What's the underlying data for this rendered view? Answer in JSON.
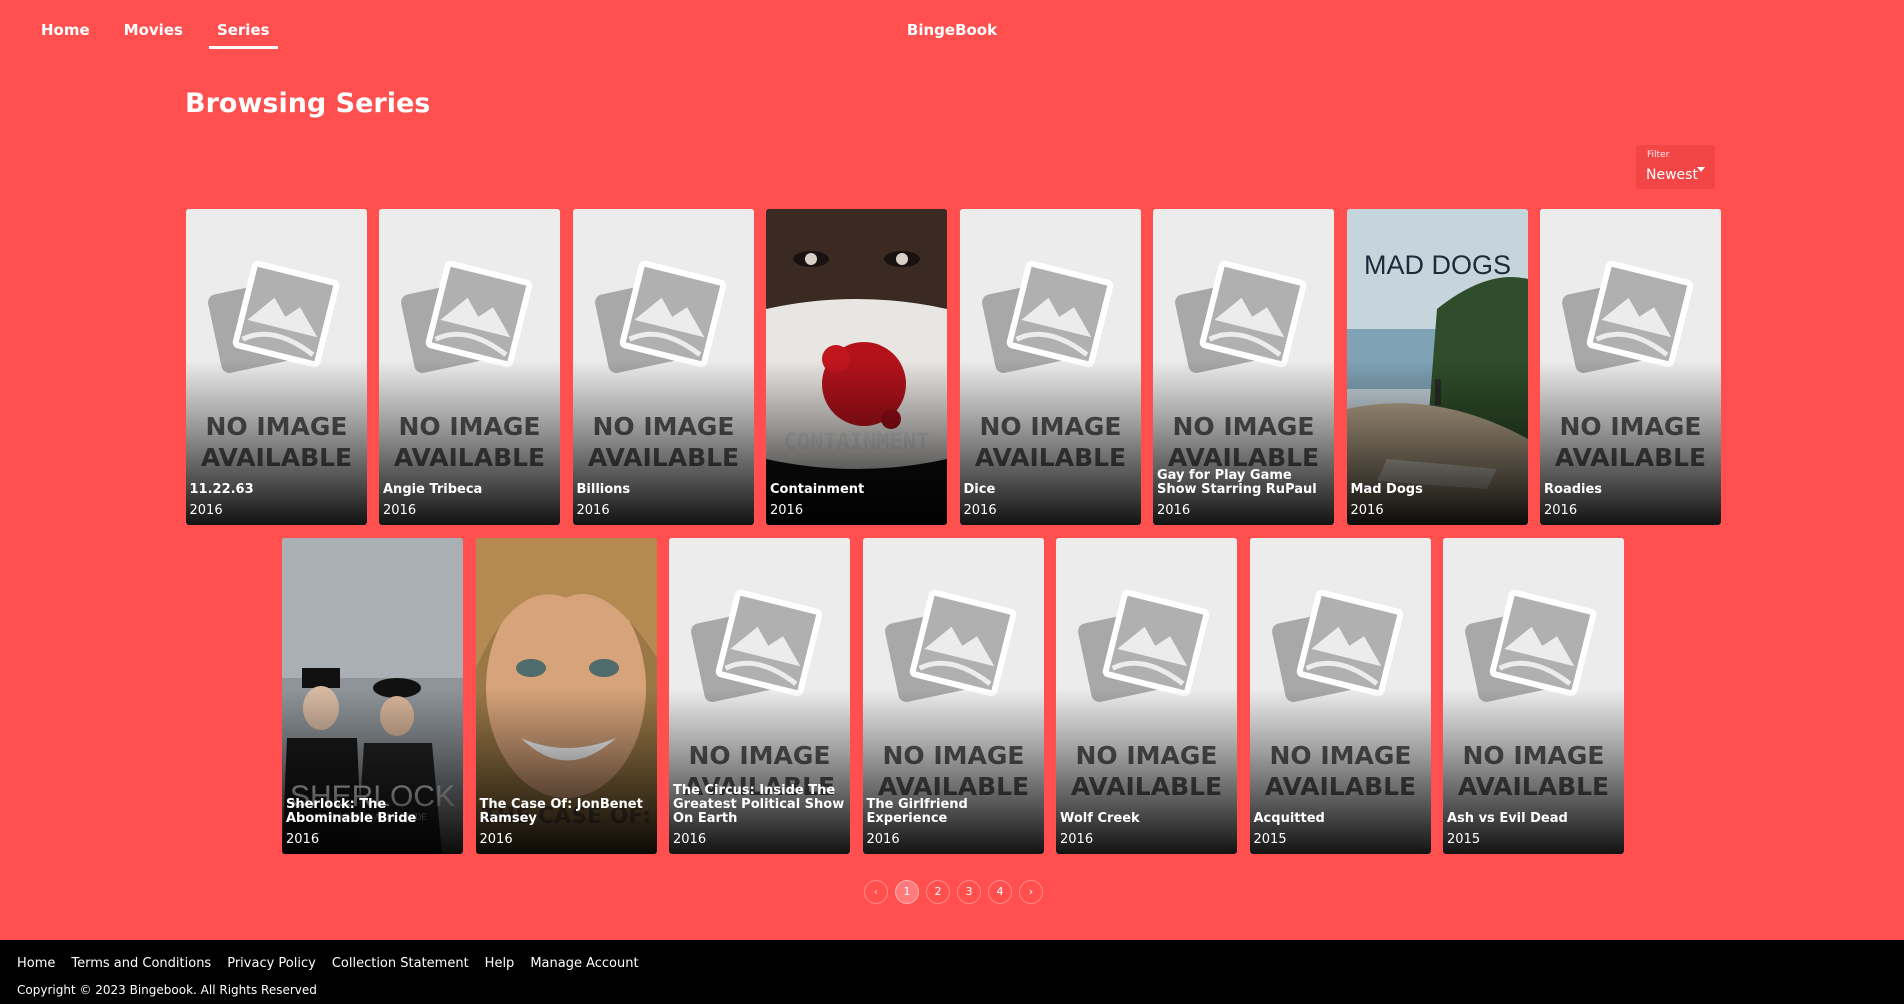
{
  "nav": {
    "home": "Home",
    "movies": "Movies",
    "series": "Series",
    "brand": "BingeBook"
  },
  "page_title": "Browsing Series",
  "filter": {
    "label": "Filter",
    "value": "Newest"
  },
  "placeholder_text": {
    "line1": "NO IMAGE",
    "line2": "AVAILABLE"
  },
  "row1": [
    {
      "title": "11.22.63",
      "year": "2016",
      "poster": "none"
    },
    {
      "title": "Angie Tribeca",
      "year": "2016",
      "poster": "none"
    },
    {
      "title": "Billions",
      "year": "2016",
      "poster": "none"
    },
    {
      "title": "Containment",
      "year": "2016",
      "poster": "containment"
    },
    {
      "title": "Dice",
      "year": "2016",
      "poster": "none"
    },
    {
      "title": "Gay for Play Game Show Starring RuPaul",
      "year": "2016",
      "poster": "none"
    },
    {
      "title": "Mad Dogs",
      "year": "2016",
      "poster": "maddogs"
    },
    {
      "title": "Roadies",
      "year": "2016",
      "poster": "none"
    }
  ],
  "row2": [
    {
      "title": "Sherlock: The Abominable Bride",
      "year": "2016",
      "poster": "sherlock"
    },
    {
      "title": "The Case Of: JonBenet Ramsey",
      "year": "2016",
      "poster": "jonbenet"
    },
    {
      "title": "The Circus: Inside The Greatest Political Show On Earth",
      "year": "2016",
      "poster": "none"
    },
    {
      "title": "The Girlfriend Experience",
      "year": "2016",
      "poster": "none"
    },
    {
      "title": "Wolf Creek",
      "year": "2016",
      "poster": "none"
    },
    {
      "title": "Acquitted",
      "year": "2015",
      "poster": "none"
    },
    {
      "title": "Ash vs Evil Dead",
      "year": "2015",
      "poster": "none"
    }
  ],
  "poster_texts": {
    "containment": "CONTAINMENT",
    "maddogs": "MAD DOGS",
    "sherlock": "SHERLOCK",
    "sherlock_sub": "THE ABOMINABLE BRIDE",
    "jonbenet": "THE CASE OF:"
  },
  "pagination": {
    "pages": [
      "1",
      "2",
      "3",
      "4"
    ],
    "current": "1",
    "prev_icon": "chevron-left-icon",
    "next_icon": "chevron-right-icon"
  },
  "footer": {
    "links": [
      "Home",
      "Terms and Conditions",
      "Privacy Policy",
      "Collection Statement",
      "Help",
      "Manage Account"
    ],
    "copyright": "Copyright © 2023 Bingebook. All Rights Reserved"
  },
  "colors": {
    "background": "#ff4f4f",
    "footer": "#000000",
    "filter_bg": "#f24545"
  }
}
